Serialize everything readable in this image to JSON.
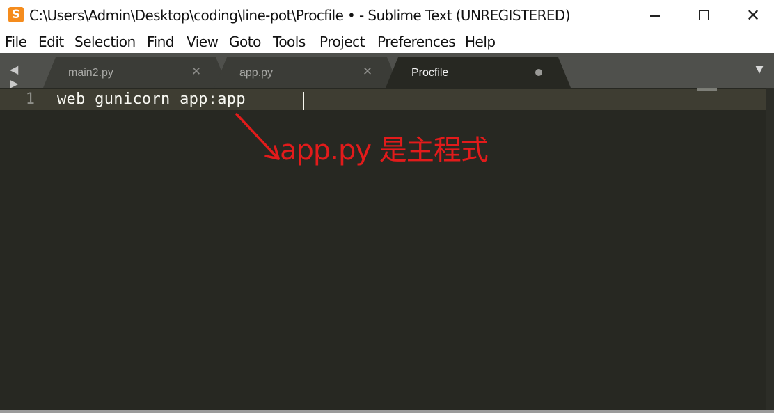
{
  "window": {
    "title": "C:\\Users\\Admin\\Desktop\\coding\\line-pot\\Procfile • - Sublime Text (UNREGISTERED)",
    "icon": "sublime-text-icon",
    "icon_glyph": "S",
    "controls": {
      "minimize_icon": "minimize-icon",
      "maximize_icon": "maximize-icon",
      "close_icon": "close-icon",
      "close_glyph": "✕"
    }
  },
  "menu": {
    "items": [
      "File",
      "Edit",
      "Selection",
      "Find",
      "View",
      "Goto",
      "Tools",
      "Project",
      "Preferences",
      "Help"
    ]
  },
  "tabs": {
    "nav_arrows": "◀ ▶",
    "items": [
      {
        "label": "main2.py",
        "active": false,
        "close_glyph": "✕"
      },
      {
        "label": "app.py",
        "active": false,
        "close_glyph": "✕"
      },
      {
        "label": "Procfile",
        "active": true,
        "modified": true
      }
    ],
    "menu_arrow": "▼"
  },
  "editor": {
    "lines": [
      {
        "number": "1",
        "text": "web gunicorn app:app"
      }
    ]
  },
  "annotation": {
    "text": "app.py 是主程式",
    "color": "#e21b1b"
  },
  "colors": {
    "editor_bg": "#272822",
    "current_line_bg": "#3e3d32",
    "tabbar_bg": "#4f504c",
    "active_tab_bg": "#272822",
    "inactive_tab_bg": "#3b3c37",
    "app_icon": "#f58c1d"
  }
}
